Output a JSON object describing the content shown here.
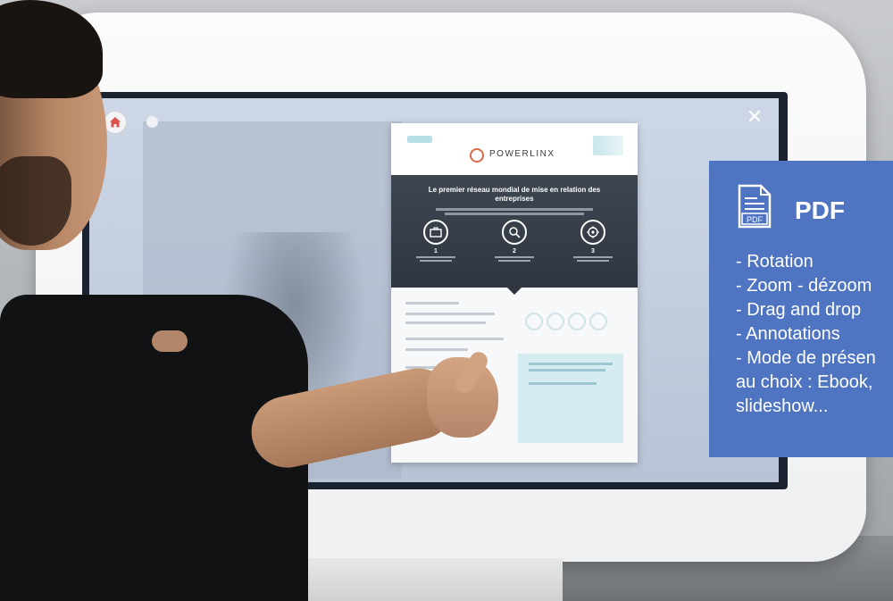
{
  "kiosk_screen": {
    "close_glyph": "✕",
    "home_icon": "home-icon"
  },
  "document": {
    "brand": "POWERLINX",
    "headline": "Le premier réseau mondial de mise en relation des entreprises",
    "steps": [
      {
        "num": "1",
        "icon": "briefcase-icon"
      },
      {
        "num": "2",
        "icon": "search-icon"
      },
      {
        "num": "3",
        "icon": "target-icon"
      }
    ]
  },
  "overlay": {
    "title": "PDF",
    "icon_label": "PDF",
    "features": [
      "- Rotation",
      "- Zoom - dézoom",
      "- Drag and drop",
      "- Annotations",
      "- Mode de présen",
      "au choix : Ebook,",
      "slideshow..."
    ],
    "colors": {
      "panel": "#4f74c1",
      "text": "#ffffff"
    }
  }
}
